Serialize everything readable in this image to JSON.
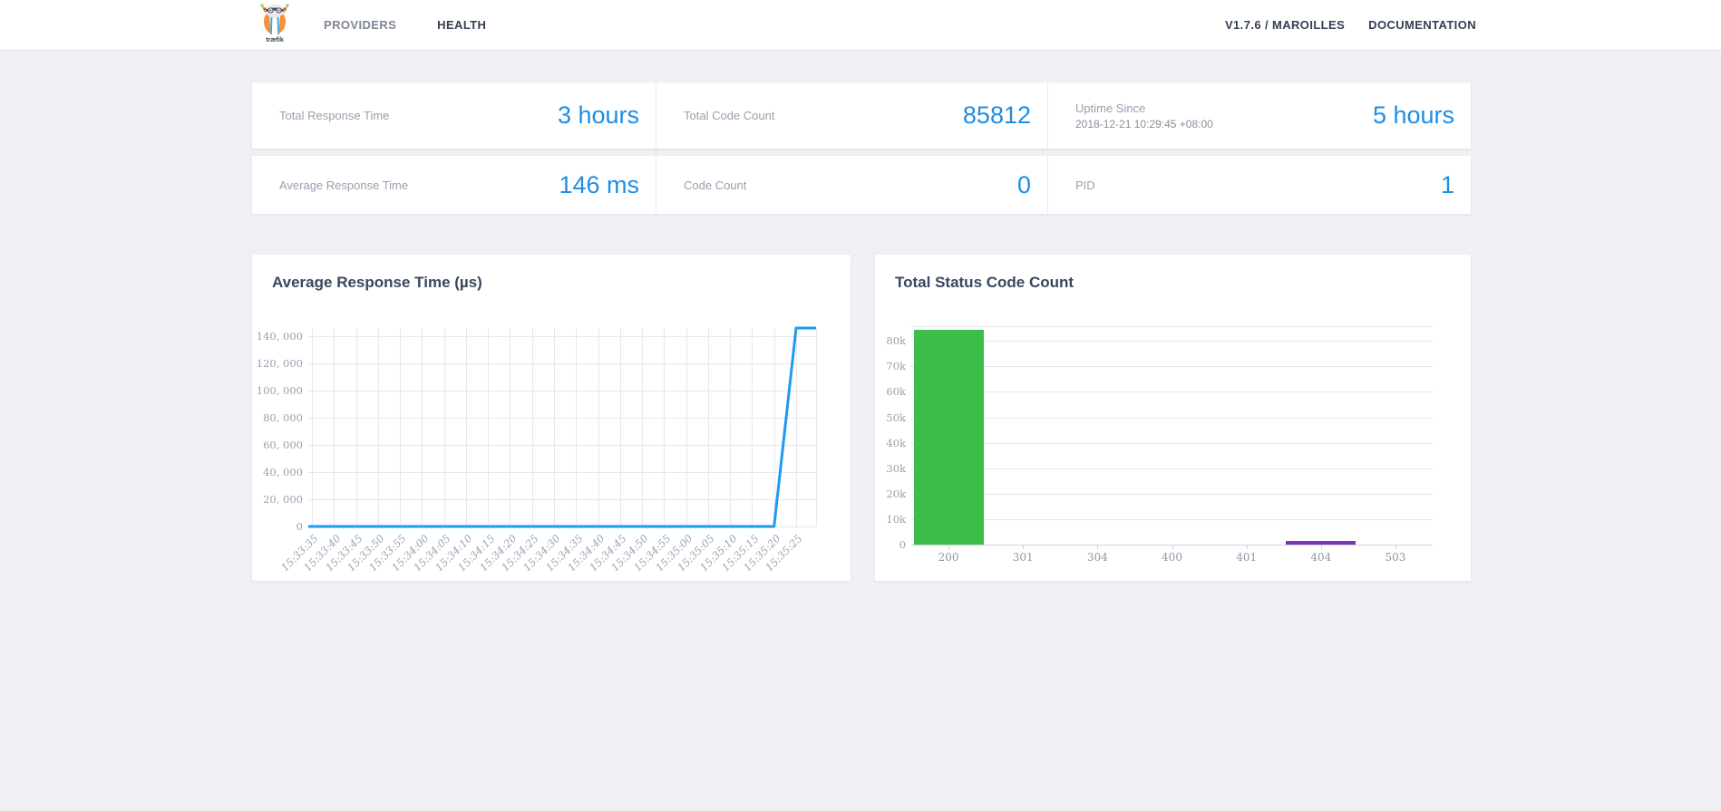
{
  "nav": {
    "logo_text": "træfik",
    "providers": "PROVIDERS",
    "health": "HEALTH",
    "version": "V1.7.6 / MAROILLES",
    "documentation": "DOCUMENTATION"
  },
  "stats": {
    "row1": [
      {
        "label": "Total Response Time",
        "value": "3 hours"
      },
      {
        "label": "Total Code Count",
        "value": "85812"
      },
      {
        "label": "Uptime Since",
        "sublabel": "2018-12-21 10:29:45 +08:00",
        "value": "5 hours"
      }
    ],
    "row2": [
      {
        "label": "Average Response Time",
        "value": "146 ms"
      },
      {
        "label": "Code Count",
        "value": "0"
      },
      {
        "label": "PID",
        "value": "1"
      }
    ]
  },
  "colors": {
    "accent_blue": "#1d8ee4",
    "line_blue": "#1e9af0",
    "bar_green": "#3dbe4a",
    "bar_purple": "#7d34b8",
    "grid": "#e5e8ee",
    "page_bg": "#eef0f4"
  },
  "chart_data": [
    {
      "type": "line",
      "title": "Average Response Time (µs)",
      "x": [
        "15:33:35",
        "15:33:40",
        "15:33:45",
        "15:33:50",
        "15:33:55",
        "15:34:00",
        "15:34:05",
        "15:34:10",
        "15:34:15",
        "15:34:20",
        "15:34:25",
        "15:34:30",
        "15:34:35",
        "15:34:40",
        "15:34:45",
        "15:34:50",
        "15:34:55",
        "15:35:00",
        "15:35:05",
        "15:35:10",
        "15:35:15",
        "15:35:20",
        "15:35:25"
      ],
      "values": [
        0,
        0,
        0,
        0,
        0,
        0,
        0,
        0,
        0,
        0,
        0,
        0,
        0,
        0,
        0,
        0,
        0,
        0,
        0,
        0,
        0,
        0,
        146000
      ],
      "ylim": [
        0,
        146000
      ],
      "yticks": [
        {
          "v": 0,
          "label": "0"
        },
        {
          "v": 20000,
          "label": "20, 000"
        },
        {
          "v": 40000,
          "label": "40, 000"
        },
        {
          "v": 60000,
          "label": "60, 000"
        },
        {
          "v": 80000,
          "label": "80, 000"
        },
        {
          "v": 100000,
          "label": "100, 000"
        },
        {
          "v": 120000,
          "label": "120, 000"
        },
        {
          "v": 140000,
          "label": "140, 000"
        }
      ],
      "grid": "both",
      "legend": "none",
      "line_color": "#1e9af0"
    },
    {
      "type": "bar",
      "title": "Total Status Code Count",
      "categories": [
        "200",
        "301",
        "304",
        "400",
        "401",
        "404",
        "503"
      ],
      "values": [
        84300,
        0,
        0,
        0,
        0,
        1500,
        0
      ],
      "bar_colors": [
        "#3dbe4a",
        "",
        "",
        "",
        "",
        "#7d34b8",
        ""
      ],
      "ylim": [
        0,
        85812
      ],
      "yticks": [
        {
          "v": 0,
          "label": "0"
        },
        {
          "v": 10000,
          "label": "10k"
        },
        {
          "v": 20000,
          "label": "20k"
        },
        {
          "v": 30000,
          "label": "30k"
        },
        {
          "v": 40000,
          "label": "40k"
        },
        {
          "v": 50000,
          "label": "50k"
        },
        {
          "v": 60000,
          "label": "60k"
        },
        {
          "v": 70000,
          "label": "70k"
        },
        {
          "v": 80000,
          "label": "80k"
        }
      ],
      "grid": "horizontal",
      "legend": "none"
    }
  ]
}
